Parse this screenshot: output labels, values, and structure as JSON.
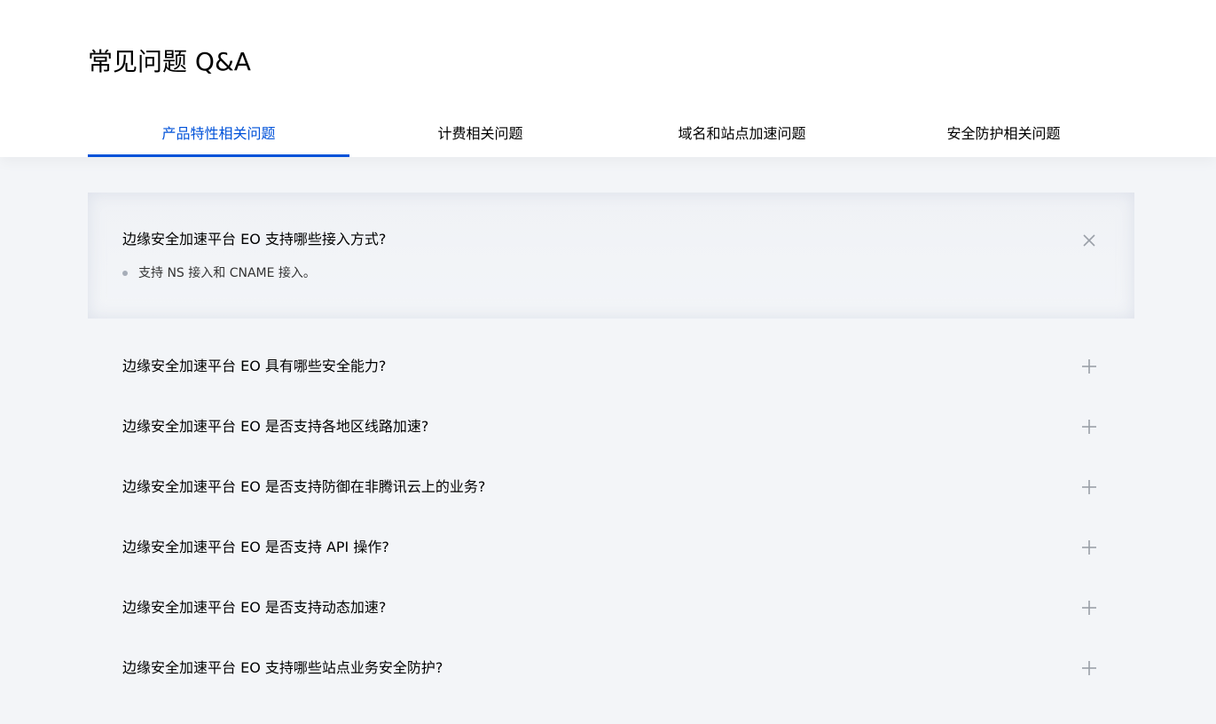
{
  "page": {
    "title": "常见问题 Q&A"
  },
  "tabs": [
    {
      "label": "产品特性相关问题",
      "active": true
    },
    {
      "label": "计费相关问题",
      "active": false
    },
    {
      "label": "域名和站点加速问题",
      "active": false
    },
    {
      "label": "安全防护相关问题",
      "active": false
    }
  ],
  "faq": [
    {
      "question": "边缘安全加速平台 EO 支持哪些接入方式?",
      "expanded": true,
      "answer": "支持 NS 接入和 CNAME 接入。",
      "toggle_icon": "close-icon"
    },
    {
      "question": "边缘安全加速平台 EO 具有哪些安全能力?",
      "expanded": false,
      "toggle_icon": "plus-icon"
    },
    {
      "question": "边缘安全加速平台 EO 是否支持各地区线路加速?",
      "expanded": false,
      "toggle_icon": "plus-icon"
    },
    {
      "question": "边缘安全加速平台 EO 是否支持防御在非腾讯云上的业务?",
      "expanded": false,
      "toggle_icon": "plus-icon"
    },
    {
      "question": "边缘安全加速平台 EO 是否支持 API 操作?",
      "expanded": false,
      "toggle_icon": "plus-icon"
    },
    {
      "question": "边缘安全加速平台 EO 是否支持动态加速?",
      "expanded": false,
      "toggle_icon": "plus-icon"
    },
    {
      "question": "边缘安全加速平台 EO 支持哪些站点业务安全防护?",
      "expanded": false,
      "toggle_icon": "plus-icon"
    }
  ],
  "colors": {
    "accent": "#0052d9",
    "icon": "#9aa0a8"
  }
}
